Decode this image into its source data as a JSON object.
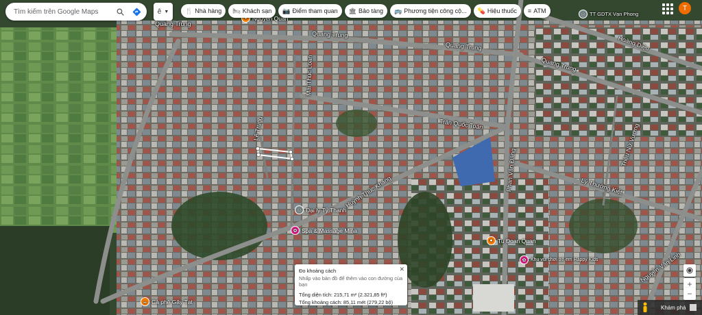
{
  "search": {
    "placeholder": "Tìm kiếm trên Google Maps"
  },
  "layers_label": "ê",
  "chips": [
    {
      "icon": "fork-knife-icon",
      "glyph": "🍴",
      "label": "Nhà hàng"
    },
    {
      "icon": "bed-icon",
      "glyph": "🛏",
      "label": "Khách sạn"
    },
    {
      "icon": "camera-icon",
      "glyph": "📷",
      "label": "Điểm tham quan"
    },
    {
      "icon": "museum-icon",
      "glyph": "🏛",
      "label": "Bảo tàng"
    },
    {
      "icon": "transit-icon",
      "glyph": "🚌",
      "label": "Phương tiện công cộ..."
    },
    {
      "icon": "pharmacy-icon",
      "glyph": "💊",
      "label": "Hiệu thuốc"
    },
    {
      "icon": "atm-icon",
      "glyph": "≡",
      "label": "ATM"
    }
  ],
  "avatar_letter": "T",
  "streets": [
    {
      "name": "Quang Trung",
      "id": "quang-trung-1"
    },
    {
      "name": "Quang Trung",
      "id": "quang-trung-2"
    },
    {
      "name": "Quang Trung",
      "id": "quang-trung-3"
    },
    {
      "name": "Quang Trung",
      "id": "quang-trung-4"
    },
    {
      "name": "Mai Thúc Loan",
      "id": "mai-thuc-loan"
    },
    {
      "name": "Trần Quốc Toản",
      "id": "tran-quoc-toan"
    },
    {
      "name": "Huỳnh Thúc Kháng",
      "id": "huynh-thuc-khang"
    },
    {
      "name": "Phan Văn Đáng",
      "id": "phan-van-dang"
    },
    {
      "name": "Lý Thường Kiệt",
      "id": "ly-thuong-kiet"
    },
    {
      "name": "Triệu Nữ Vương",
      "id": "trieu-nu-vuong"
    },
    {
      "name": "Hoàng Diệu",
      "id": "hoang-dieu"
    },
    {
      "name": "Nguyễn Văn Linh",
      "id": "nguyen-van-linh"
    },
    {
      "name": "Lê Trung",
      "id": "le-trung"
    }
  ],
  "pois": [
    {
      "name": "Đại lý Tỷ Thanh",
      "color": "#7b8d8f",
      "glyph": "◎"
    },
    {
      "name": "Spa & Massage Mina",
      "color": "#e91e8c",
      "glyph": "✿"
    },
    {
      "name": "Tu Đoan Quan",
      "color": "#f57c00",
      "glyph": "●"
    },
    {
      "name": "Khu vui chơi trẻ em Happy Kids",
      "color": "#e91e8c",
      "glyph": "✿"
    },
    {
      "name": "Cà phê Gây Tạt",
      "color": "#f57c00",
      "glyph": "☕"
    },
    {
      "name": "TT GDTX Vạn Phong",
      "color": "#7b8d8f",
      "glyph": "◎"
    },
    {
      "name": "Nguyễn Quán",
      "color": "#f57c00",
      "glyph": "●"
    }
  ],
  "measure": {
    "title": "Đo khoảng cách",
    "subtitle": "Nhấp vào bản đồ để thêm vào con đường của bạn",
    "area": "Tổng diện tích: 215,71 m² (2.321,85 ft²)",
    "distance": "Tổng khoảng cách: 85,11 mét (279,22 bộ)"
  },
  "bottom": {
    "explore_label": "Khám phá"
  },
  "colors": {
    "accent_blue": "#1a73e8",
    "avatar": "#ef6c00",
    "poi_pink": "#e91e8c",
    "poi_orange": "#f57c00"
  }
}
